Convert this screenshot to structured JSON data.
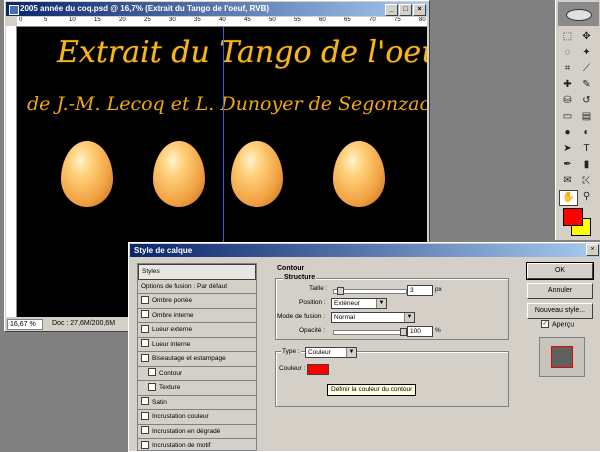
{
  "document": {
    "title": "2005 année du coq.psd @ 16,7% (Extrait du Tango de l'oeuf, RVB)",
    "ruler_top": [
      "0",
      "5",
      "10",
      "15",
      "20",
      "25",
      "30",
      "35",
      "40",
      "45",
      "50",
      "55",
      "60",
      "65",
      "70",
      "75",
      "80"
    ],
    "status_zoom": "16,67 %",
    "status_doc": "Doc : 27,6M/200,6M",
    "canvas_title_line1": "Extrait du Tango de l'oeuf",
    "canvas_title_line2": "de J.-M. Lecoq et L. Dunoyer de Segonzac",
    "window_buttons": [
      "_",
      "□",
      "×"
    ]
  },
  "toolbox": {
    "foreground_color": "#ff0000",
    "background_color": "#ffff00",
    "tools": [
      "marquee-icon",
      "move-icon",
      "lasso-icon",
      "magic-wand-icon",
      "crop-icon",
      "slice-icon",
      "healing-icon",
      "brush-icon",
      "stamp-icon",
      "history-brush-icon",
      "eraser-icon",
      "gradient-icon",
      "blur-icon",
      "dodge-icon",
      "path-select-icon",
      "type-icon",
      "pen-icon",
      "shape-icon",
      "notes-icon",
      "eyedropper-icon",
      "hand-icon",
      "zoom-icon"
    ]
  },
  "dialog": {
    "title": "Style de calque",
    "close": "×",
    "styles_header": "Styles",
    "styles": [
      {
        "label": "Options de fusion : Par défaut",
        "checkbox": false,
        "indent": false,
        "selected": false
      },
      {
        "label": "Ombre portée",
        "checkbox": true,
        "indent": false,
        "selected": false
      },
      {
        "label": "Ombre interne",
        "checkbox": true,
        "indent": false,
        "selected": false
      },
      {
        "label": "Lueur externe",
        "checkbox": true,
        "indent": false,
        "selected": false
      },
      {
        "label": "Lueur interne",
        "checkbox": true,
        "indent": false,
        "selected": false
      },
      {
        "label": "Biseautage et estampage",
        "checkbox": true,
        "indent": false,
        "selected": false
      },
      {
        "label": "Contour",
        "checkbox": true,
        "indent": true,
        "selected": false
      },
      {
        "label": "Texture",
        "checkbox": true,
        "indent": true,
        "selected": false
      },
      {
        "label": "Satin",
        "checkbox": true,
        "indent": false,
        "selected": false
      },
      {
        "label": "Incrustation couleur",
        "checkbox": true,
        "indent": false,
        "selected": false
      },
      {
        "label": "Incrustation en dégradé",
        "checkbox": true,
        "indent": false,
        "selected": false
      },
      {
        "label": "Incrustation de motif",
        "checkbox": true,
        "indent": false,
        "selected": false
      },
      {
        "label": "",
        "checkbox": true,
        "indent": false,
        "selected": true
      }
    ],
    "section_title": "Contour",
    "structure_label": "Structure",
    "size_label": "Taille :",
    "size_value": "3",
    "size_unit": "px",
    "size_level": 0.04,
    "position_label": "Position :",
    "position_value": "Extérieur",
    "blend_label": "Mode de fusion :",
    "blend_value": "Normal",
    "opacity_label": "Opacité :",
    "opacity_value": "100",
    "opacity_unit": "%",
    "opacity_level": 1.0,
    "type_label": "Type :",
    "type_value": "Couleur",
    "color_label": "Couleur :",
    "stroke_color": "#ff0000",
    "tooltip": "Définir la couleur du contour",
    "ok_label": "OK",
    "cancel_label": "Annuler",
    "new_style_label": "Nouveau style...",
    "preview_label": "Aperçu",
    "preview_checked": true
  }
}
